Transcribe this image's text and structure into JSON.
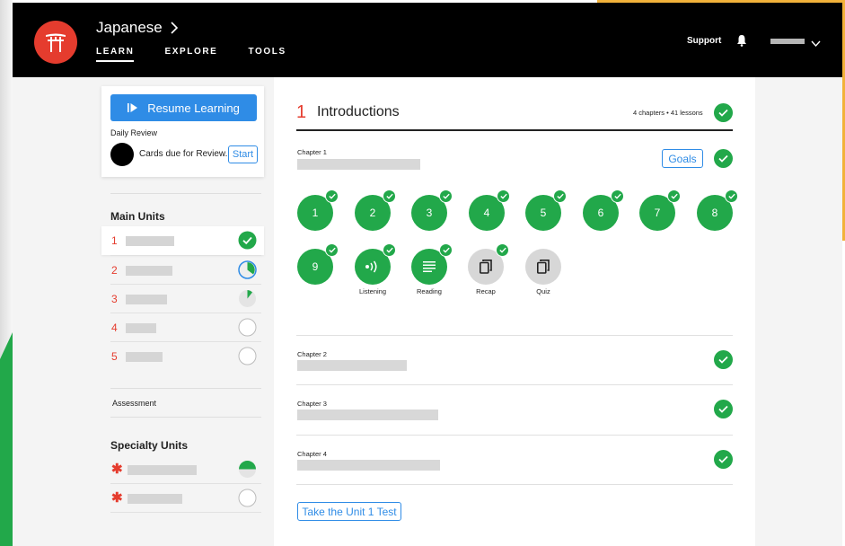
{
  "header": {
    "language": "Japanese",
    "nav": [
      {
        "label": "LEARN",
        "active": true
      },
      {
        "label": "EXPLORE",
        "active": false
      },
      {
        "label": "TOOLS",
        "active": false
      }
    ],
    "support_label": "Support"
  },
  "sidebar": {
    "resume_label": "Resume Learning",
    "daily_review_label": "Daily Review",
    "cards_due_text": "Cards due for Review.",
    "start_label": "Start",
    "main_units_heading": "Main Units",
    "units": [
      {
        "number": "1",
        "status": "complete",
        "progress": 1.0,
        "selected": true
      },
      {
        "number": "2",
        "status": "in-progress",
        "progress": 0.4,
        "selected": false
      },
      {
        "number": "3",
        "status": "in-progress",
        "progress": 0.1,
        "selected": false
      },
      {
        "number": "4",
        "status": "not-started",
        "progress": 0,
        "selected": false
      },
      {
        "number": "5",
        "status": "not-started",
        "progress": 0,
        "selected": false
      }
    ],
    "assessment_label": "Assessment",
    "specialty_heading": "Specialty Units",
    "specialty_units": [
      {
        "symbol": "✱",
        "status": "in-progress",
        "progress": 0.5
      },
      {
        "symbol": "✱",
        "status": "not-started",
        "progress": 0
      }
    ]
  },
  "main": {
    "unit_number": "1",
    "unit_title": "Introductions",
    "meta": "4 chapters • 41 lessons",
    "goals_label": "Goals",
    "chapters": [
      {
        "label": "Chapter 1",
        "complete": true
      },
      {
        "label": "Chapter 2",
        "complete": true
      },
      {
        "label": "Chapter 3",
        "complete": true
      },
      {
        "label": "Chapter 4",
        "complete": true
      }
    ],
    "lessons_row1": [
      "1",
      "2",
      "3",
      "4",
      "5",
      "6",
      "7",
      "8"
    ],
    "lesson_9": "9",
    "activities": {
      "listening": "Listening",
      "reading": "Reading",
      "recap": "Recap",
      "quiz": "Quiz"
    },
    "test_button": "Take the Unit 1 Test"
  },
  "colors": {
    "brand_red": "#e53c2e",
    "accent_blue": "#2f8ce6",
    "complete_green": "#22a84a"
  }
}
